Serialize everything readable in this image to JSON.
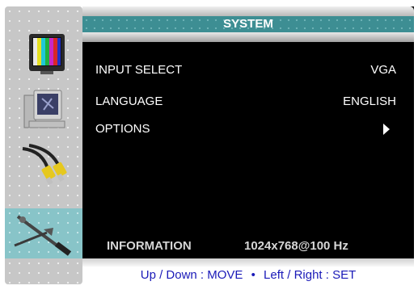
{
  "title": "SYSTEM",
  "sidebar": {
    "items": [
      {
        "icon": "color-bars-monitor-icon",
        "active": false
      },
      {
        "icon": "computer-monitor-icon",
        "active": false
      },
      {
        "icon": "av-cable-icon",
        "active": false
      },
      {
        "icon": "tools-icon",
        "active": true
      }
    ]
  },
  "menu": {
    "input_select": {
      "label": "INPUT SELECT",
      "value": "VGA"
    },
    "language": {
      "label": "LANGUAGE",
      "value": "ENGLISH"
    },
    "options": {
      "label": "OPTIONS",
      "indicator": "submenu-arrow"
    }
  },
  "information": {
    "label": "INFORMATION",
    "value": "1024x768@100 Hz"
  },
  "help": {
    "move": "Up / Down : MOVE",
    "separator": "•",
    "set": "Left / Right : SET"
  },
  "colors": {
    "title_bar": "#3d8e93",
    "active_item": "#88c4c8",
    "panel": "#000000",
    "help_text": "#1a1ab8"
  }
}
